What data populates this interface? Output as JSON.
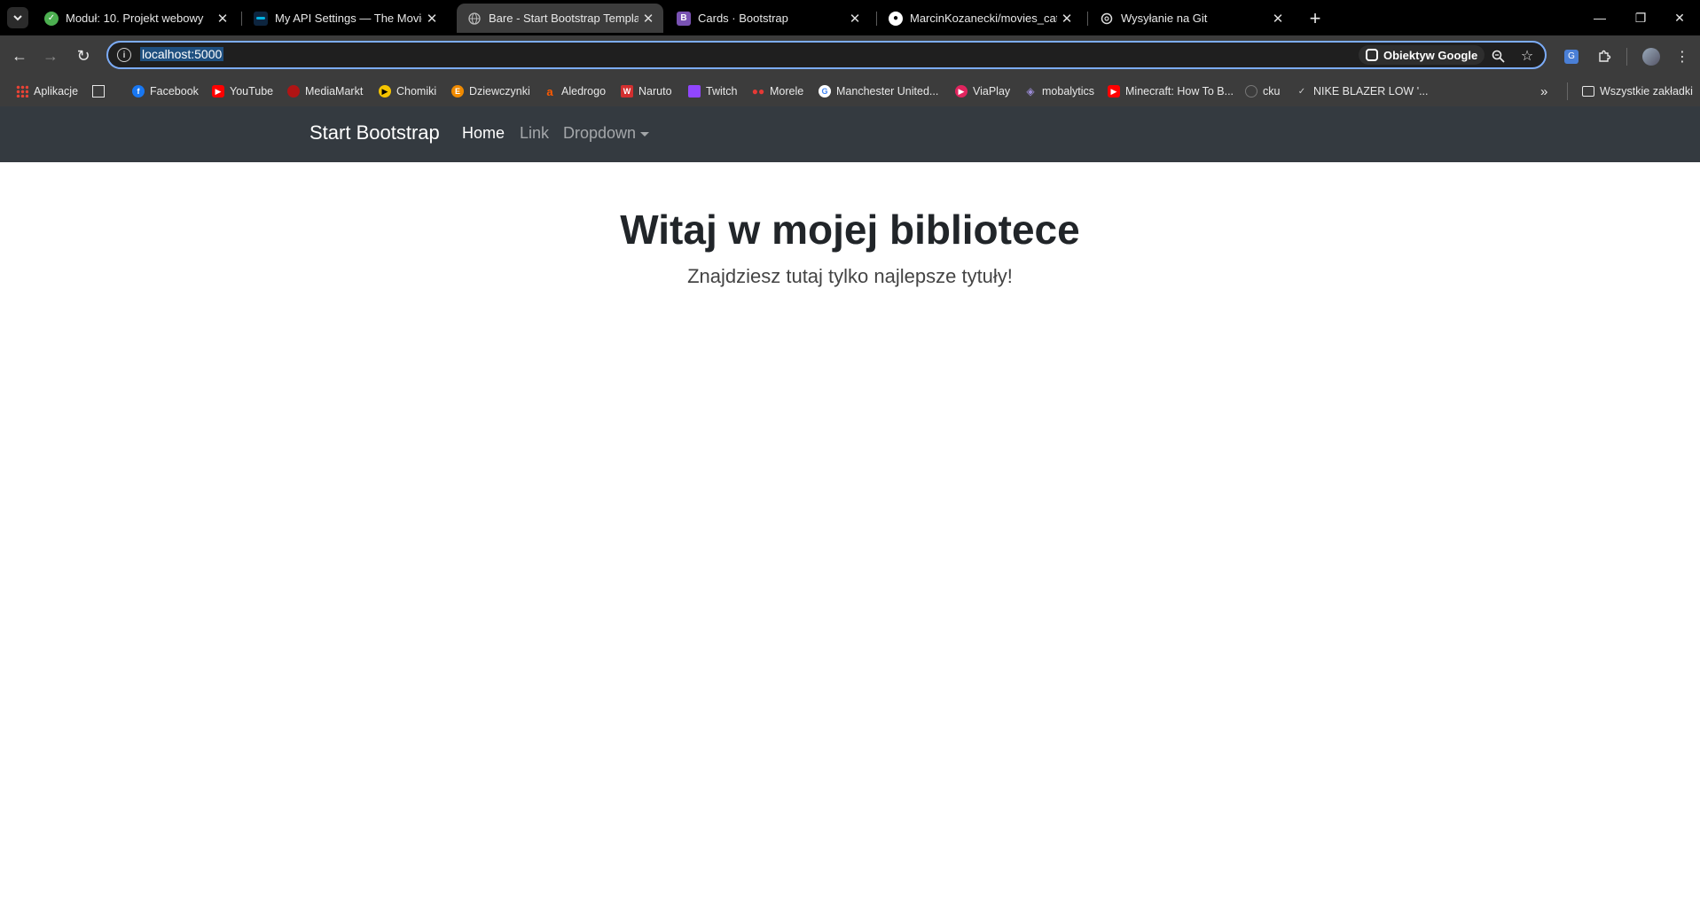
{
  "browser": {
    "tabs": [
      {
        "title": "Moduł: 10. Projekt webowy",
        "favicon": "green-check-icon",
        "active": false
      },
      {
        "title": "My API Settings — The Movie D",
        "favicon": "tmdb-icon",
        "active": false
      },
      {
        "title": "Bare - Start Bootstrap Template",
        "favicon": "globe-icon",
        "active": true
      },
      {
        "title": "Cards · Bootstrap",
        "favicon": "bootstrap-icon",
        "active": false
      },
      {
        "title": "MarcinKozanecki/movies_catalo",
        "favicon": "github-icon",
        "active": false
      },
      {
        "title": "Wysyłanie na Git",
        "favicon": "openai-icon",
        "active": false
      }
    ],
    "address_bar": {
      "url": "localhost:5000",
      "lens_label": "Obiektyw Google"
    },
    "bookmarks": [
      {
        "label": "Aplikacje",
        "icon": "apps-grid-icon"
      },
      {
        "label": "",
        "icon": "grid-icon"
      },
      {
        "label": "Facebook",
        "icon": "facebook-icon"
      },
      {
        "label": "YouTube",
        "icon": "youtube-icon"
      },
      {
        "label": "MediaMarkt",
        "icon": "mediamarkt-icon"
      },
      {
        "label": "Chomiki",
        "icon": "chomiki-icon"
      },
      {
        "label": "Dziewczynki",
        "icon": "dziewczynki-icon"
      },
      {
        "label": "Aledrogo",
        "icon": "allegro-icon"
      },
      {
        "label": "Naruto",
        "icon": "naruto-icon"
      },
      {
        "label": "Twitch",
        "icon": "twitch-icon"
      },
      {
        "label": "Morele",
        "icon": "morele-icon"
      },
      {
        "label": "Manchester United...",
        "icon": "google-icon"
      },
      {
        "label": "ViaPlay",
        "icon": "viaplay-icon"
      },
      {
        "label": "mobalytics",
        "icon": "mobalytics-icon"
      },
      {
        "label": "Minecraft: How To B...",
        "icon": "youtube-icon"
      },
      {
        "label": "cku",
        "icon": "cku-icon"
      },
      {
        "label": "NIKE BLAZER LOW '...",
        "icon": "nike-icon"
      }
    ],
    "all_bookmarks_label": "Wszystkie zakładki"
  },
  "page": {
    "navbar": {
      "brand": "Start Bootstrap",
      "links": [
        "Home",
        "Link",
        "Dropdown"
      ]
    },
    "hero": {
      "title": "Witaj w mojej bibliotece",
      "lead": "Znajdziesz tutaj tylko najlepsze tytuły!"
    }
  },
  "colors": {
    "navbar_bg": "#343a40",
    "tabstrip_bg": "#000000",
    "toolbar_bg": "#3c3c3c",
    "omnibox_focus": "#7cacf8"
  }
}
